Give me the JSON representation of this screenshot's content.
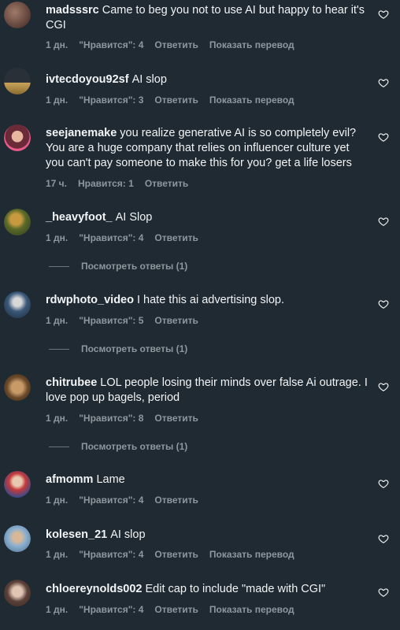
{
  "comments": [
    {
      "user": "madsssrc",
      "text": "Came to beg you not to use AI but happy to hear it's CGI",
      "time": "1 дн.",
      "likes": "\"Нравится\": 4",
      "reply": "Ответить",
      "translate": "Показать перевод"
    },
    {
      "user": "ivtecdoyou92sf",
      "text": "AI slop",
      "time": "1 дн.",
      "likes": "\"Нравится\": 3",
      "reply": "Ответить",
      "translate": "Показать перевод"
    },
    {
      "user": "seejanemake",
      "text": "you realize generative AI is so completely evil? You are a huge company that relies on influencer culture yet you can't pay someone to make this for you? get a life losers",
      "time": "17 ч.",
      "likes": "Нравится: 1",
      "reply": "Ответить"
    },
    {
      "user": "_heavyfoot_",
      "text": "AI Slop",
      "time": "1 дн.",
      "likes": "\"Нравится\": 4",
      "reply": "Ответить",
      "view_replies": "Посмотреть ответы (1)"
    },
    {
      "user": "rdwphoto_video",
      "text": "I hate this ai advertising slop.",
      "time": "1 дн.",
      "likes": "\"Нравится\": 5",
      "reply": "Ответить",
      "view_replies": "Посмотреть ответы (1)"
    },
    {
      "user": "chitrubee",
      "text": "LOL people losing their minds over false Ai outrage. I love pop up bagels, period",
      "time": "1 дн.",
      "likes": "\"Нравится\": 8",
      "reply": "Ответить",
      "view_replies": "Посмотреть ответы (1)"
    },
    {
      "user": "afmomm",
      "text": "Lame",
      "time": "1 дн.",
      "likes": "\"Нравится\": 4",
      "reply": "Ответить"
    },
    {
      "user": "kolesen_21",
      "text": "AI slop",
      "time": "1 дн.",
      "likes": "\"Нравится\": 4",
      "reply": "Ответить",
      "translate": "Показать перевод"
    },
    {
      "user": "chloereynolds002",
      "text": "Edit cap to include \"made with CGI\"",
      "time": "1 дн.",
      "likes": "\"Нравится\": 4",
      "reply": "Ответить",
      "translate": "Показать перевод"
    }
  ]
}
